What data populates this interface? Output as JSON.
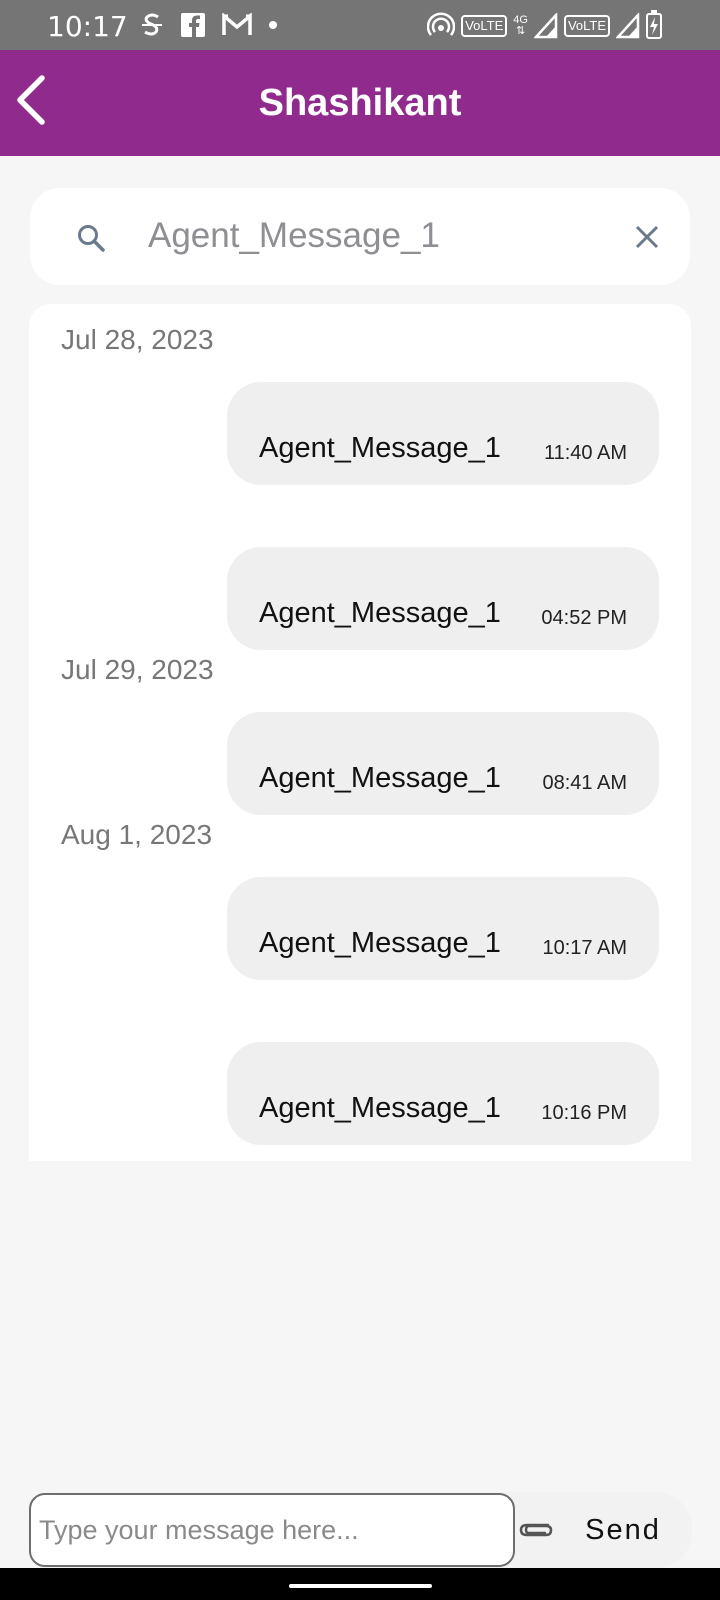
{
  "status_bar": {
    "time": "10:17",
    "left_icons": [
      "s-icon",
      "facebook-icon",
      "gmail-icon",
      "dot-icon"
    ],
    "right_icons": [
      "hotspot-icon",
      "volte-icon",
      "signal-icon",
      "volte-icon",
      "signal-icon",
      "battery-icon"
    ],
    "volte_label": "VoLTE",
    "network_label": "4G"
  },
  "app_bar": {
    "title": "Shashikant",
    "color": "#912a8d"
  },
  "search": {
    "value": "Agent_Message_1",
    "placeholder": "Agent_Message_1"
  },
  "messages": [
    {
      "date": "Jul 28, 2023",
      "text": "Agent_Message_1",
      "time": "11:40 AM"
    },
    {
      "text": "Agent_Message_1",
      "time": "04:52 PM"
    },
    {
      "date": "Jul 29, 2023",
      "text": "Agent_Message_1",
      "time": "08:41 AM"
    },
    {
      "date": "Aug 1, 2023",
      "text": "Agent_Message_1",
      "time": "10:17 AM"
    },
    {
      "text": "Agent_Message_1",
      "time": "10:16 PM"
    }
  ],
  "compose": {
    "placeholder": "Type your message here...",
    "send_label": "Send"
  }
}
